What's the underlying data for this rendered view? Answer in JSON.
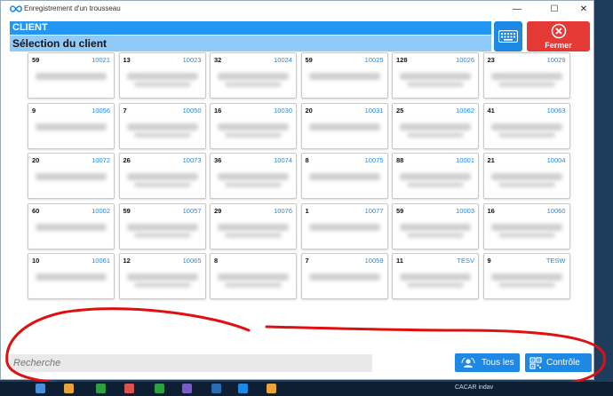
{
  "window": {
    "title": "Enregistrement d'un trousseau"
  },
  "header": {
    "section": "CLIENT",
    "subtitle": "Sélection du client",
    "close_label": "Fermer"
  },
  "search": {
    "placeholder": "Recherche"
  },
  "buttons": {
    "all_label": "Tous les",
    "control_label": "Contrôle"
  },
  "cards": [
    {
      "count": "59",
      "code": "10021"
    },
    {
      "count": "13",
      "code": "10023"
    },
    {
      "count": "32",
      "code": "10024"
    },
    {
      "count": "59",
      "code": "10025"
    },
    {
      "count": "128",
      "code": "10026"
    },
    {
      "count": "23",
      "code": "10029"
    },
    {
      "count": "9",
      "code": "10056"
    },
    {
      "count": "7",
      "code": "10050"
    },
    {
      "count": "16",
      "code": "10030"
    },
    {
      "count": "20",
      "code": "10031"
    },
    {
      "count": "25",
      "code": "10062"
    },
    {
      "count": "41",
      "code": "10063"
    },
    {
      "count": "20",
      "code": "10072"
    },
    {
      "count": "26",
      "code": "10073"
    },
    {
      "count": "36",
      "code": "10074"
    },
    {
      "count": "8",
      "code": "10075"
    },
    {
      "count": "88",
      "code": "10001"
    },
    {
      "count": "21",
      "code": "10004"
    },
    {
      "count": "60",
      "code": "10002"
    },
    {
      "count": "59",
      "code": "10057"
    },
    {
      "count": "29",
      "code": "10076"
    },
    {
      "count": "1",
      "code": "10077"
    },
    {
      "count": "59",
      "code": "10003"
    },
    {
      "count": "16",
      "code": "10060"
    },
    {
      "count": "10",
      "code": "10061"
    },
    {
      "count": "12",
      "code": "10065"
    },
    {
      "count": "8",
      "code": ""
    },
    {
      "count": "7",
      "code": "10059"
    },
    {
      "count": "11",
      "code": "TESV"
    },
    {
      "count": "9",
      "code": "TESW"
    }
  ],
  "taskbar": {
    "tray_label": "CACAR indav"
  },
  "colors": {
    "accent": "#1e88e5",
    "header_blue": "#2196f3",
    "header_light": "#90caf9",
    "close_red": "#e53935",
    "annotation": "#e01010"
  },
  "icons": {
    "app": "infinity-icon",
    "keyboard": "keyboard-icon",
    "close": "close-circle-icon",
    "all": "users-icon",
    "control": "qr-code-icon"
  }
}
